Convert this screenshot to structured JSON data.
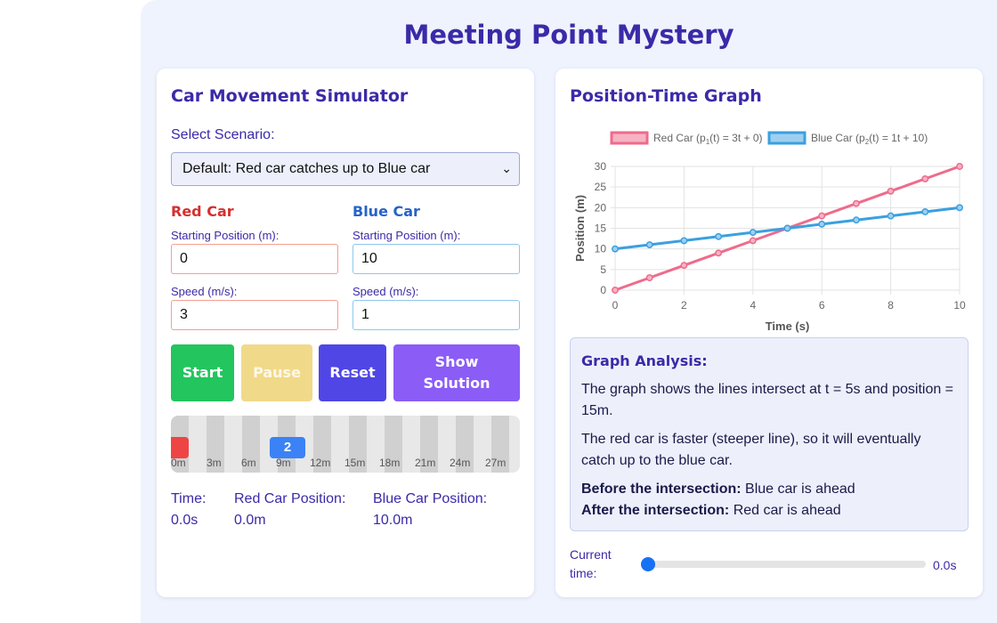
{
  "title": "Meeting Point Mystery",
  "simulator": {
    "heading": "Car Movement Simulator",
    "scenario_label": "Select Scenario:",
    "scenario_value": "Default: Red car catches up to Blue car",
    "red": {
      "title": "Red Car",
      "start_label": "Starting Position (m):",
      "start_value": "0",
      "speed_label": "Speed (m/s):",
      "speed_value": "3",
      "color": "#d62f2f"
    },
    "blue": {
      "title": "Blue Car",
      "start_label": "Starting Position (m):",
      "start_value": "10",
      "speed_label": "Speed (m/s):",
      "speed_value": "1",
      "color": "#2563c9"
    },
    "buttons": {
      "start": "Start",
      "pause": "Pause",
      "reset": "Reset",
      "solution": "Show Solution"
    },
    "button_colors": {
      "start": "#22c55e",
      "pause": "#f1d98a",
      "reset": "#4f46e5",
      "solution": "#8b5cf6"
    },
    "track_ticks": [
      "0m",
      "3m",
      "6m",
      "9m",
      "12m",
      "15m",
      "18m",
      "21m",
      "24m",
      "27m"
    ],
    "blue_car_label": "2",
    "stats": {
      "time_label": "Time:",
      "time_value": "0.0s",
      "red_label": "Red Car Position:",
      "red_value": "0.0m",
      "blue_label": "Blue Car Position:",
      "blue_value": "10.0m"
    }
  },
  "graph": {
    "heading": "Position-Time Graph",
    "analysis": {
      "heading": "Graph Analysis:",
      "p1": "The graph shows the lines intersect at t = 5s and position = 15m.",
      "p2": "The red car is faster (steeper line), so it will eventually catch up to the blue car.",
      "before_label": "Before the intersection:",
      "before_value": " Blue car is ahead",
      "after_label": "After the intersection:",
      "after_value": " Red car is ahead"
    },
    "current_time_label": "Current time:",
    "current_time_value": "0.0s",
    "slider_fraction": 0
  },
  "chart_data": {
    "type": "line",
    "xlabel": "Time (s)",
    "ylabel": "Position (m)",
    "xlim": [
      0,
      10
    ],
    "ylim": [
      0,
      30
    ],
    "x_ticks": [
      "0",
      "2",
      "4",
      "6",
      "8",
      "10"
    ],
    "y_ticks": [
      "0",
      "5",
      "10",
      "15",
      "20",
      "25",
      "30"
    ],
    "grid": true,
    "legend_position": "top",
    "x": [
      0,
      1,
      2,
      3,
      4,
      5,
      6,
      7,
      8,
      9,
      10
    ],
    "series": [
      {
        "name": "Red Car (p",
        "sub": "1",
        "suffix": "(t) = 3t + 0)",
        "color": "#ee6b8c",
        "fill": "#f7b3c4",
        "values": [
          0,
          3,
          6,
          9,
          12,
          15,
          18,
          21,
          24,
          27,
          30
        ]
      },
      {
        "name": "Blue Car (p",
        "sub": "2",
        "suffix": "(t) = 1t + 10)",
        "color": "#3aa0e0",
        "fill": "#9fcff0",
        "values": [
          10,
          11,
          12,
          13,
          14,
          15,
          16,
          17,
          18,
          19,
          20
        ]
      }
    ]
  }
}
